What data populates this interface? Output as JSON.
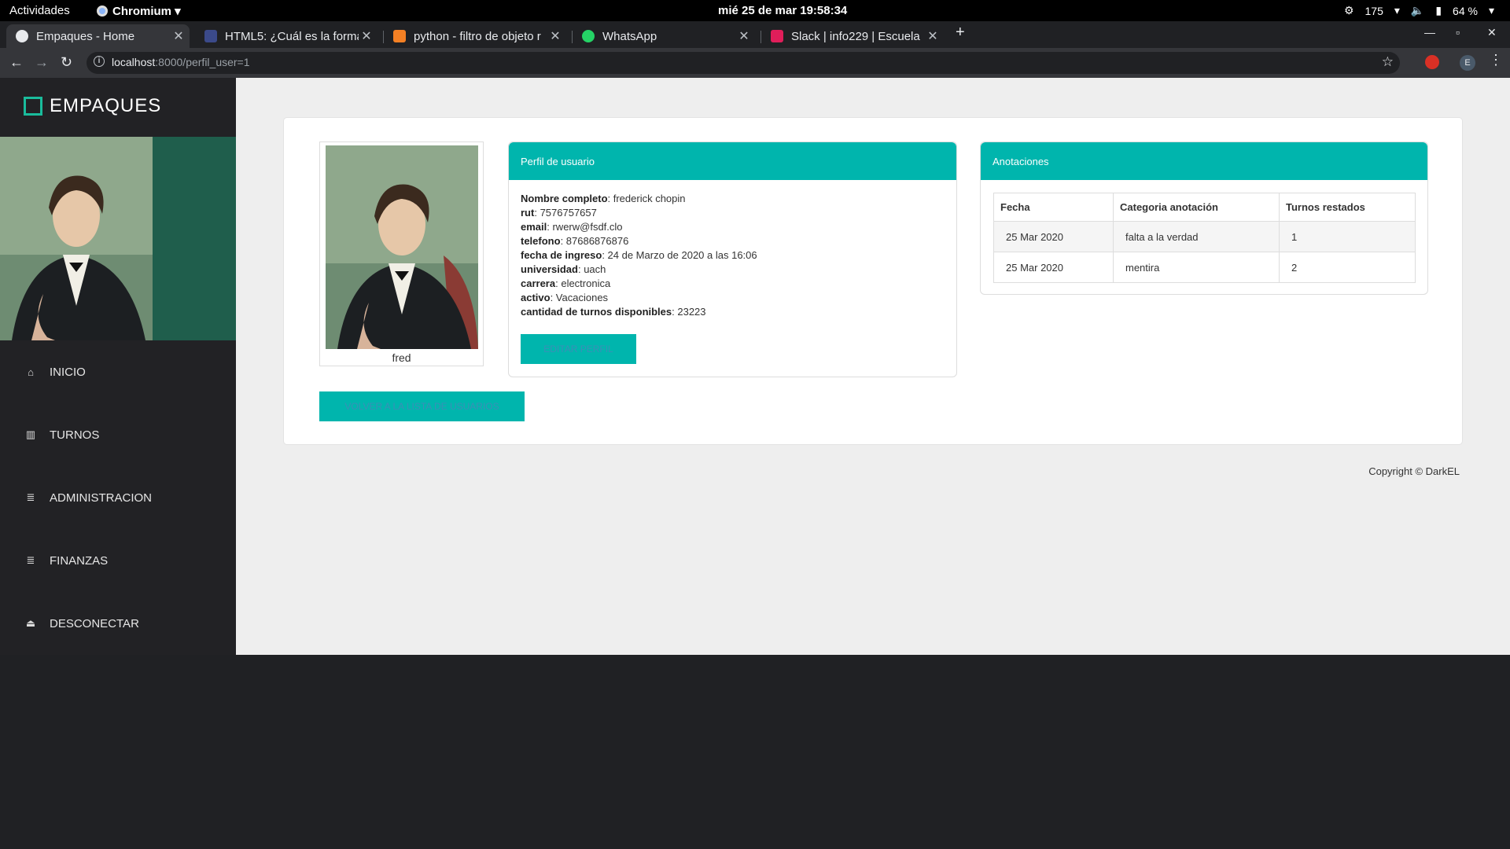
{
  "gnome": {
    "activities": "Actividades",
    "app": "Chromium",
    "clock": "mié 25 de mar  19:58:34",
    "updates": "175",
    "battery": "64 %"
  },
  "tabs": [
    {
      "title": "Empaques - Home",
      "active": true,
      "icon_color": "#e8eaed"
    },
    {
      "title": "HTML5: ¿Cuál es la forma",
      "active": false,
      "icon_color": "#3b4a8a"
    },
    {
      "title": "python - filtro de objeto r",
      "active": false,
      "icon_color": "#f48024"
    },
    {
      "title": "WhatsApp",
      "active": false,
      "icon_color": "#25d366"
    },
    {
      "title": "Slack | info229 | Escuela",
      "active": false,
      "icon_color": "#e01e5a"
    }
  ],
  "omnibox": {
    "host": "localhost",
    "rest": ":8000/perfil_user=1"
  },
  "ext_avatar": "E",
  "brand": "EMPAQUES",
  "menu": [
    {
      "label": "INICIO",
      "icon": "home-icon"
    },
    {
      "label": "TURNOS",
      "icon": "bar-chart-icon"
    },
    {
      "label": "ADMINISTRACION",
      "icon": "database-icon"
    },
    {
      "label": "FINANZAS",
      "icon": "database-icon"
    },
    {
      "label": "DESCONECTAR",
      "icon": "eject-icon"
    }
  ],
  "photo_caption": "fred",
  "profile": {
    "title": "Perfil de usuario",
    "fields": [
      {
        "label": "Nombre completo",
        "value": ": frederick chopin"
      },
      {
        "label": "rut",
        "value": ": 7576757657"
      },
      {
        "label": "email",
        "value": ": rwerw@fsdf.clo"
      },
      {
        "label": "telefono",
        "value": ": 87686876876"
      },
      {
        "label": "fecha de ingreso",
        "value": ": 24 de Marzo de 2020 a las 16:06"
      },
      {
        "label": "universidad",
        "value": ": uach"
      },
      {
        "label": "carrera",
        "value": ": electronica"
      },
      {
        "label": "activo",
        "value": ": Vacaciones"
      },
      {
        "label": "cantidad de turnos disponibles",
        "value": ": 23223"
      }
    ],
    "edit_button": "EDITAR PERFIL"
  },
  "back_button": "VOLVER A LA LISTA DE USUARIOS",
  "notes": {
    "title": "Anotaciones",
    "headers": [
      "Fecha",
      "Categoria anotación",
      "Turnos restados"
    ],
    "rows": [
      [
        "25 Mar 2020",
        "falta a la verdad",
        "1"
      ],
      [
        "25 Mar 2020",
        "mentira",
        "2"
      ]
    ]
  },
  "copyright": "Copyright © DarkEL",
  "colors": {
    "accent": "#00b5ad",
    "brand_box": "#1abc9c",
    "sidebar": "#222225",
    "hero": "#1f5e4c"
  }
}
